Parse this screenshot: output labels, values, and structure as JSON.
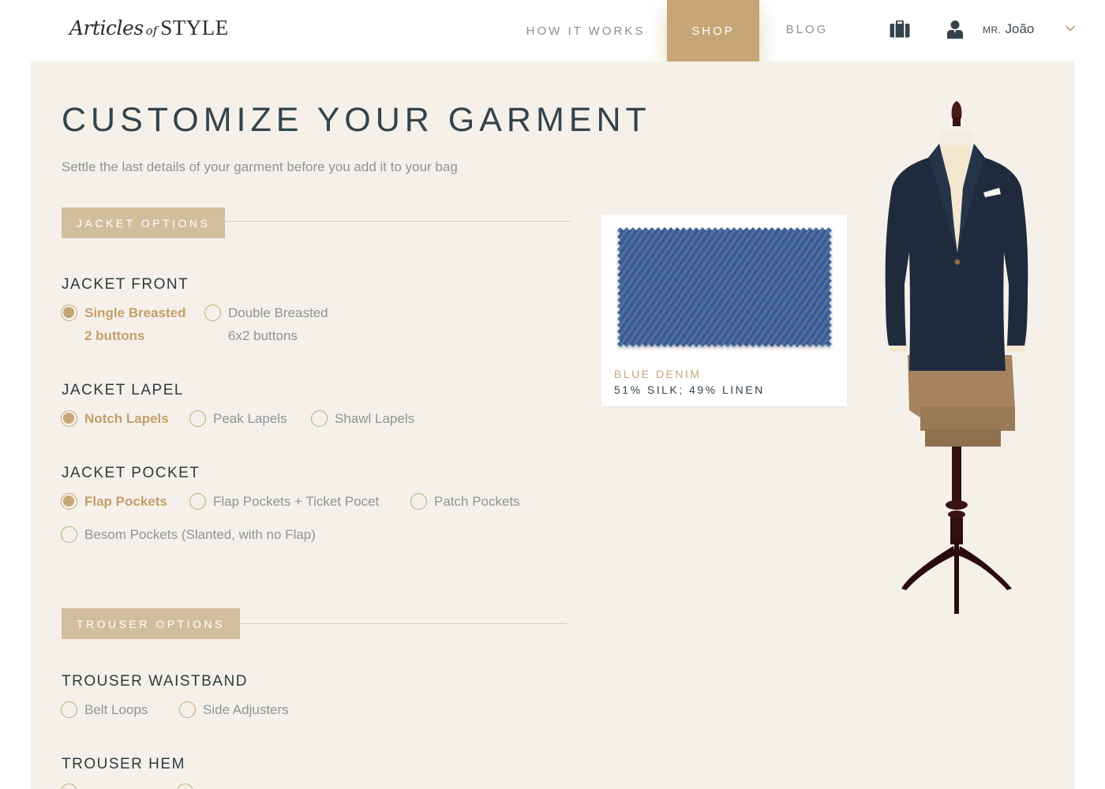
{
  "brand": {
    "script": "Articles",
    "of": "of",
    "caps": "STYLE"
  },
  "nav": {
    "how_it_works": "HOW IT WORKS",
    "shop": "SHOP",
    "blog": "BLOG",
    "active": "shop"
  },
  "user": {
    "prefix": "MR.",
    "name": "João"
  },
  "page": {
    "title": "CUSTOMIZE YOUR GARMENT",
    "subtitle": "Settle the last details of your garment before you add it to your bag"
  },
  "jacket": {
    "section_label": "JACKET OPTIONS",
    "front": {
      "title": "JACKET FRONT",
      "options": [
        {
          "label": "Single Breasted",
          "sub": "2 buttons",
          "selected": true
        },
        {
          "label": "Double Breasted",
          "sub": "6x2 buttons",
          "selected": false
        }
      ]
    },
    "lapel": {
      "title": "JACKET LAPEL",
      "options": [
        {
          "label": "Notch Lapels",
          "selected": true
        },
        {
          "label": "Peak Lapels",
          "selected": false
        },
        {
          "label": "Shawl Lapels",
          "selected": false
        }
      ]
    },
    "pocket": {
      "title": "JACKET POCKET",
      "options": [
        {
          "label": "Flap Pockets",
          "selected": true
        },
        {
          "label": "Flap Pockets + Ticket Pocet",
          "selected": false
        },
        {
          "label": "Patch Pockets",
          "selected": false
        },
        {
          "label": "Besom Pockets (Slanted, with no Flap)",
          "selected": false
        }
      ]
    }
  },
  "trouser": {
    "section_label": "TROUSER OPTIONS",
    "waistband": {
      "title": "TROUSER WAISTBAND",
      "options": [
        {
          "label": "Belt Loops",
          "selected": false
        },
        {
          "label": "Side Adjusters",
          "selected": false
        }
      ]
    },
    "hem": {
      "title": "TROUSER HEM"
    }
  },
  "fabric": {
    "name": "BLUE DENIM",
    "composition": "51% SILK; 49% LINEN",
    "color": "#3f5e95"
  },
  "colors": {
    "accent": "#c6a676",
    "panel": "#f5f1ea",
    "heading": "#34434b",
    "muted": "#8e9498"
  },
  "icons": {
    "bag": "briefcase-icon",
    "user": "user-icon",
    "dropdown": "chevron-down-icon"
  }
}
